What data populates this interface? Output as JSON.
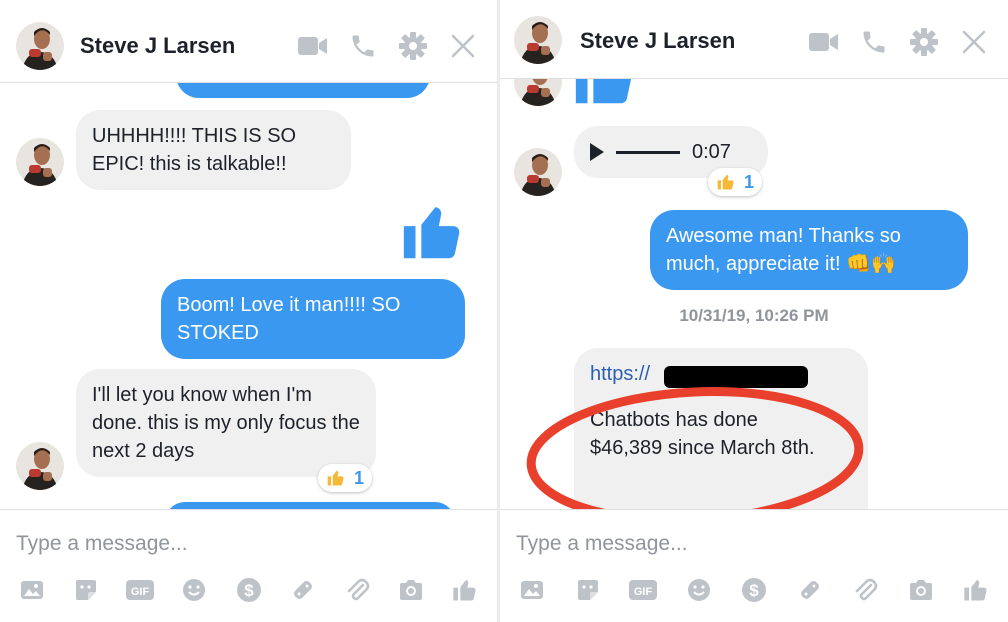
{
  "colors": {
    "accent": "#3b98f0",
    "icon": "#bec2c9",
    "incoming": "#f1f0f0",
    "annotation": "#e8402c"
  },
  "left": {
    "header": {
      "name": "Steve J Larsen"
    },
    "messages": [
      {
        "text": "UHHHH!!!! THIS IS SO EPIC! this is talkable!!"
      },
      {
        "text": "Boom! Love it man!!!! SO STOKED"
      },
      {
        "text": "I'll let you know when I'm done. this is my only focus the next 2 days",
        "reaction_count": "1"
      }
    ],
    "composer": {
      "placeholder": "Type a message..."
    }
  },
  "right": {
    "header": {
      "name": "Steve J Larsen"
    },
    "audio": {
      "duration": "0:07",
      "reaction_count": "1"
    },
    "messages": [
      {
        "text": "Awesome man! Thanks so much, appreciate it! 👊🙌"
      },
      {
        "link": "https://",
        "text": "Chatbots has done $46,389 since March 8th."
      }
    ],
    "timestamp": "10/31/19, 10:26 PM",
    "composer": {
      "placeholder": "Type a message..."
    }
  },
  "icons": {
    "header": [
      "video-camera-icon",
      "phone-icon",
      "gear-icon",
      "close-icon"
    ],
    "toolbar": [
      "photo-icon",
      "sticker-icon",
      "gif-icon",
      "emoji-icon",
      "payment-icon",
      "games-icon",
      "attachment-icon",
      "camera-icon",
      "thumbs-up-icon"
    ]
  }
}
